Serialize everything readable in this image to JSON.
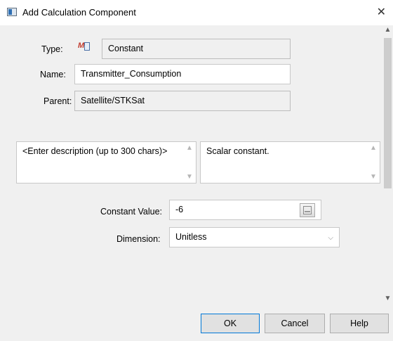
{
  "window": {
    "title": "Add Calculation Component",
    "close_glyph": "✕"
  },
  "form": {
    "type_label": "Type:",
    "type_value": "Constant",
    "name_label": "Name:",
    "name_value": "Transmitter_Consumption",
    "parent_label": "Parent:",
    "parent_value": "Satellite/STKSat",
    "description_value": "<Enter description (up to 300 chars)>",
    "details_value": "Scalar constant.",
    "constant_value_label": "Constant Value:",
    "constant_value": "-6",
    "dimension_label": "Dimension:",
    "dimension_value": "Unitless"
  },
  "buttons": {
    "ok": "OK",
    "cancel": "Cancel",
    "help": "Help"
  },
  "icons": {
    "app": "window-app-icon",
    "type": "math-calc-icon",
    "calculator": "calculator-icon",
    "scroll_up": "▲",
    "scroll_down": "▼",
    "chevron": "⌵"
  }
}
